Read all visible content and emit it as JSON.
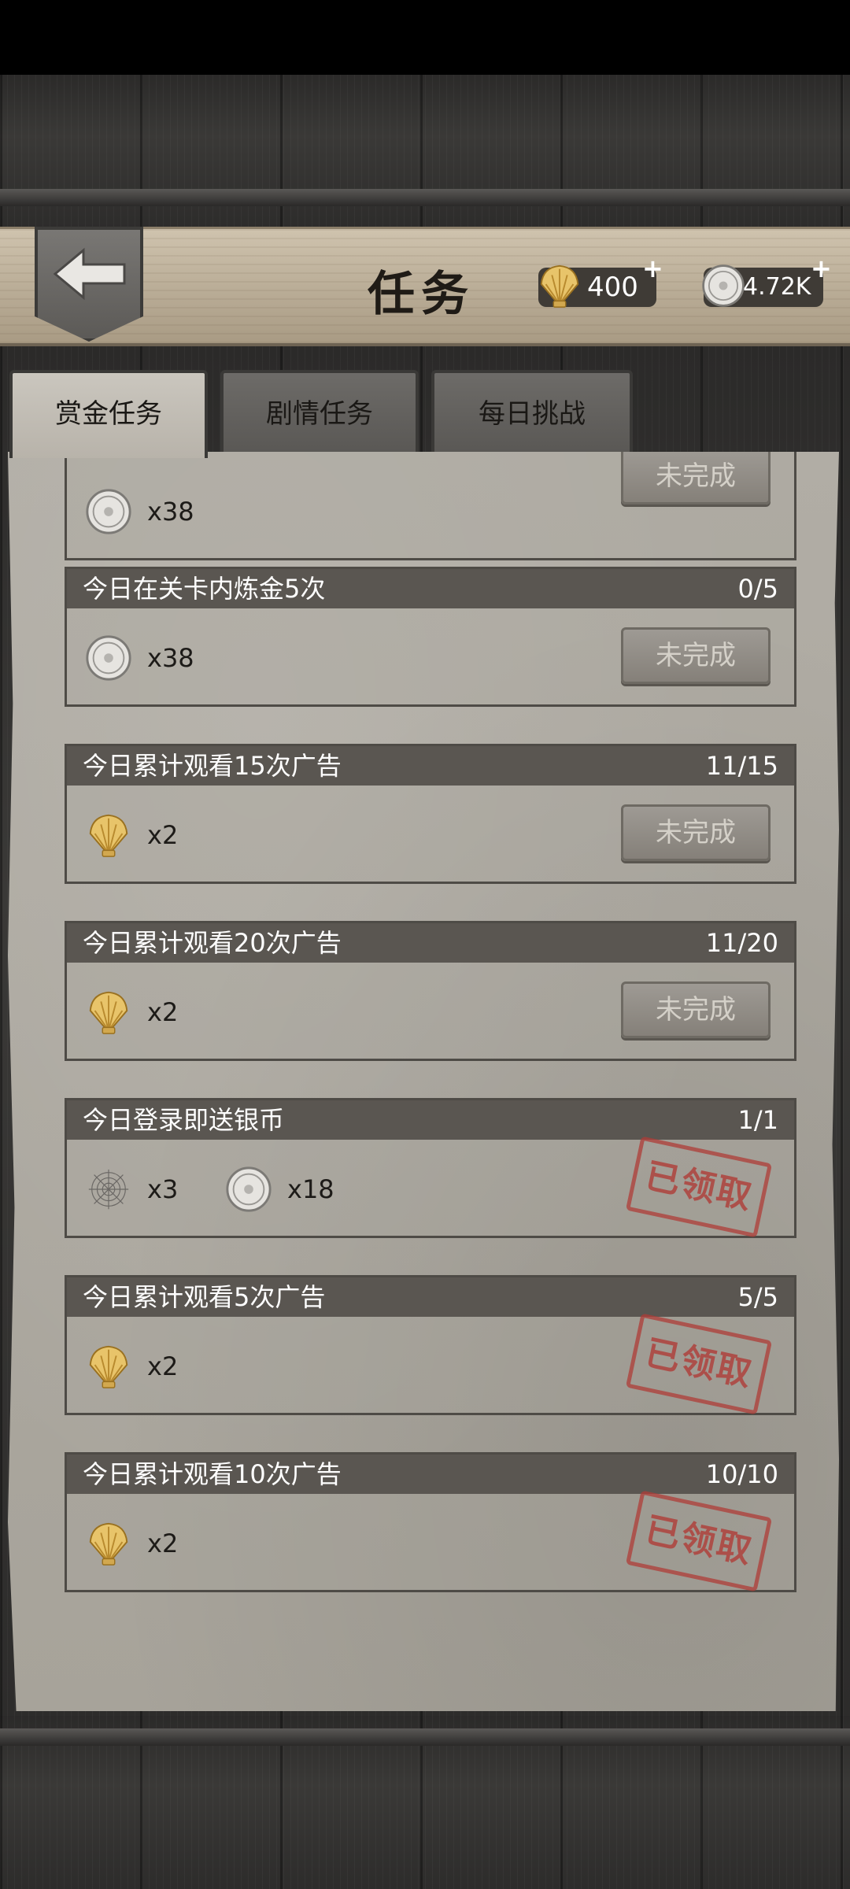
{
  "header": {
    "title": "任务",
    "shell_amount": "400",
    "coin_amount": "4.72K",
    "plus_symbol": "+"
  },
  "tabs": [
    {
      "label": "赏金任务",
      "active": true
    },
    {
      "label": "剧情任务",
      "active": false
    },
    {
      "label": "每日挑战",
      "active": false
    }
  ],
  "tasks": [
    {
      "title": "今日在关卡内炼金5次",
      "progress": "0/5",
      "rewards": [
        {
          "icon": "silver-coin-icon",
          "amount": "x38"
        }
      ],
      "status": "未完成"
    },
    {
      "title": "今日累计观看15次广告",
      "progress": "11/15",
      "rewards": [
        {
          "icon": "shell-icon",
          "amount": "x2"
        }
      ],
      "status": "未完成"
    },
    {
      "title": "今日累计观看20次广告",
      "progress": "11/20",
      "rewards": [
        {
          "icon": "shell-icon",
          "amount": "x2"
        }
      ],
      "status": "未完成"
    },
    {
      "title": "今日登录即送银币",
      "progress": "1/1",
      "rewards": [
        {
          "icon": "spider-web-icon",
          "amount": "x3"
        },
        {
          "icon": "silver-coin-icon",
          "amount": "x18"
        }
      ],
      "status": "已领取"
    },
    {
      "title": "今日累计观看5次广告",
      "progress": "5/5",
      "rewards": [
        {
          "icon": "shell-icon",
          "amount": "x2"
        }
      ],
      "status": "已领取"
    },
    {
      "title": "今日累计观看10次广告",
      "progress": "10/10",
      "rewards": [
        {
          "icon": "shell-icon",
          "amount": "x2"
        }
      ],
      "status": "已领取"
    }
  ],
  "partial_task": {
    "reward_amount": "x38",
    "status": "未完成"
  }
}
